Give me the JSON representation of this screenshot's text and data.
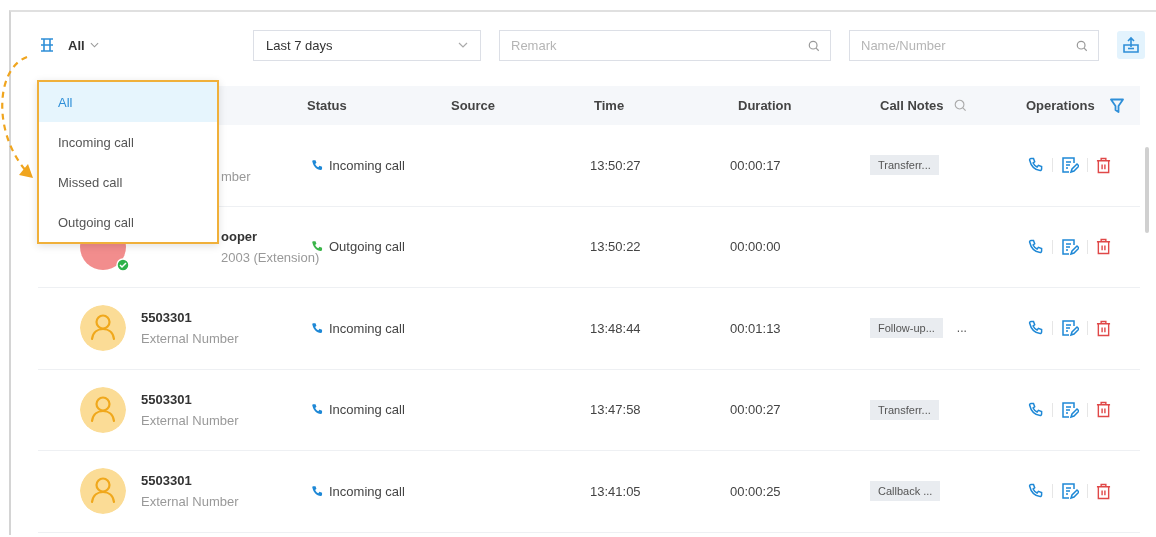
{
  "toolbar": {
    "type_filter": {
      "value": "All"
    },
    "date_range": {
      "value": "Last 7 days"
    },
    "remark_search": {
      "placeholder": "Remark"
    },
    "name_search": {
      "placeholder": "Name/Number"
    }
  },
  "type_menu": {
    "options": [
      {
        "label": "All",
        "selected": true
      },
      {
        "label": "Incoming call",
        "selected": false
      },
      {
        "label": "Missed call",
        "selected": false
      },
      {
        "label": "Outgoing call",
        "selected": false
      }
    ]
  },
  "table": {
    "columns": [
      "Status",
      "Source",
      "Time",
      "Duration",
      "Call Notes",
      "Operations"
    ],
    "rows": [
      {
        "visible_number": "mber",
        "kind": "incoming",
        "status": "Incoming call",
        "time": "13:50:27",
        "duration": "00:00:17",
        "notes": [
          "Transferr..."
        ]
      },
      {
        "avatar": {
          "kind": "initials",
          "online": true
        },
        "visible_name": "ooper",
        "number": "2003 (Extension)",
        "kind": "outgoing",
        "status": "Outgoing call",
        "time": "13:50:22",
        "duration": "00:00:00",
        "notes": []
      },
      {
        "avatar": {
          "kind": "person"
        },
        "name": "5503301",
        "number": "External Number",
        "kind": "incoming",
        "status": "Incoming call",
        "time": "13:48:44",
        "duration": "00:01:13",
        "notes": [
          "Follow-up..."
        ],
        "more_notes": "..."
      },
      {
        "avatar": {
          "kind": "person"
        },
        "name": "5503301",
        "number": "External Number",
        "kind": "incoming",
        "status": "Incoming call",
        "time": "13:47:58",
        "duration": "00:00:27",
        "notes": [
          "Transferr..."
        ]
      },
      {
        "avatar": {
          "kind": "person"
        },
        "name": "5503301",
        "number": "External Number",
        "kind": "incoming",
        "status": "Incoming call",
        "time": "13:41:05",
        "duration": "00:00:25",
        "notes": [
          "Callback ..."
        ]
      }
    ]
  }
}
